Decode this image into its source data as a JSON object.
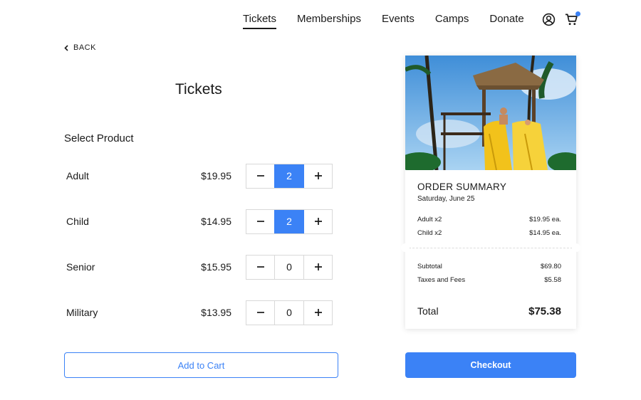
{
  "nav": {
    "items": [
      {
        "label": "Tickets",
        "active": true
      },
      {
        "label": "Memberships"
      },
      {
        "label": "Events"
      },
      {
        "label": "Camps"
      },
      {
        "label": "Donate"
      }
    ],
    "icons": [
      "user-icon",
      "cart-icon"
    ],
    "cart_badge_color": "#3b82f6"
  },
  "back_label": "BACK",
  "page_title": "Tickets",
  "section_label": "Select Product",
  "products": [
    {
      "name": "Adult",
      "price": "$19.95",
      "qty": "2",
      "selected": true
    },
    {
      "name": "Child",
      "price": "$14.95",
      "qty": "2",
      "selected": true
    },
    {
      "name": "Senior",
      "price": "$15.95",
      "qty": "0",
      "selected": false
    },
    {
      "name": "Military",
      "price": "$13.95",
      "qty": "0",
      "selected": false
    }
  ],
  "add_to_cart_label": "Add to Cart",
  "summary": {
    "title": "ORDER SUMMARY",
    "date": "Saturday, June 25",
    "items": [
      {
        "label": "Adult x2",
        "price": "$19.95 ea."
      },
      {
        "label": "Child x2",
        "price": "$14.95 ea."
      }
    ],
    "subtotal_label": "Subtotal",
    "subtotal": "$69.80",
    "fees_label": "Taxes and Fees",
    "fees": "$5.58",
    "total_label": "Total",
    "total": "$75.38"
  },
  "checkout_label": "Checkout",
  "colors": {
    "accent": "#3b82f6",
    "text": "#1a1a1a"
  }
}
